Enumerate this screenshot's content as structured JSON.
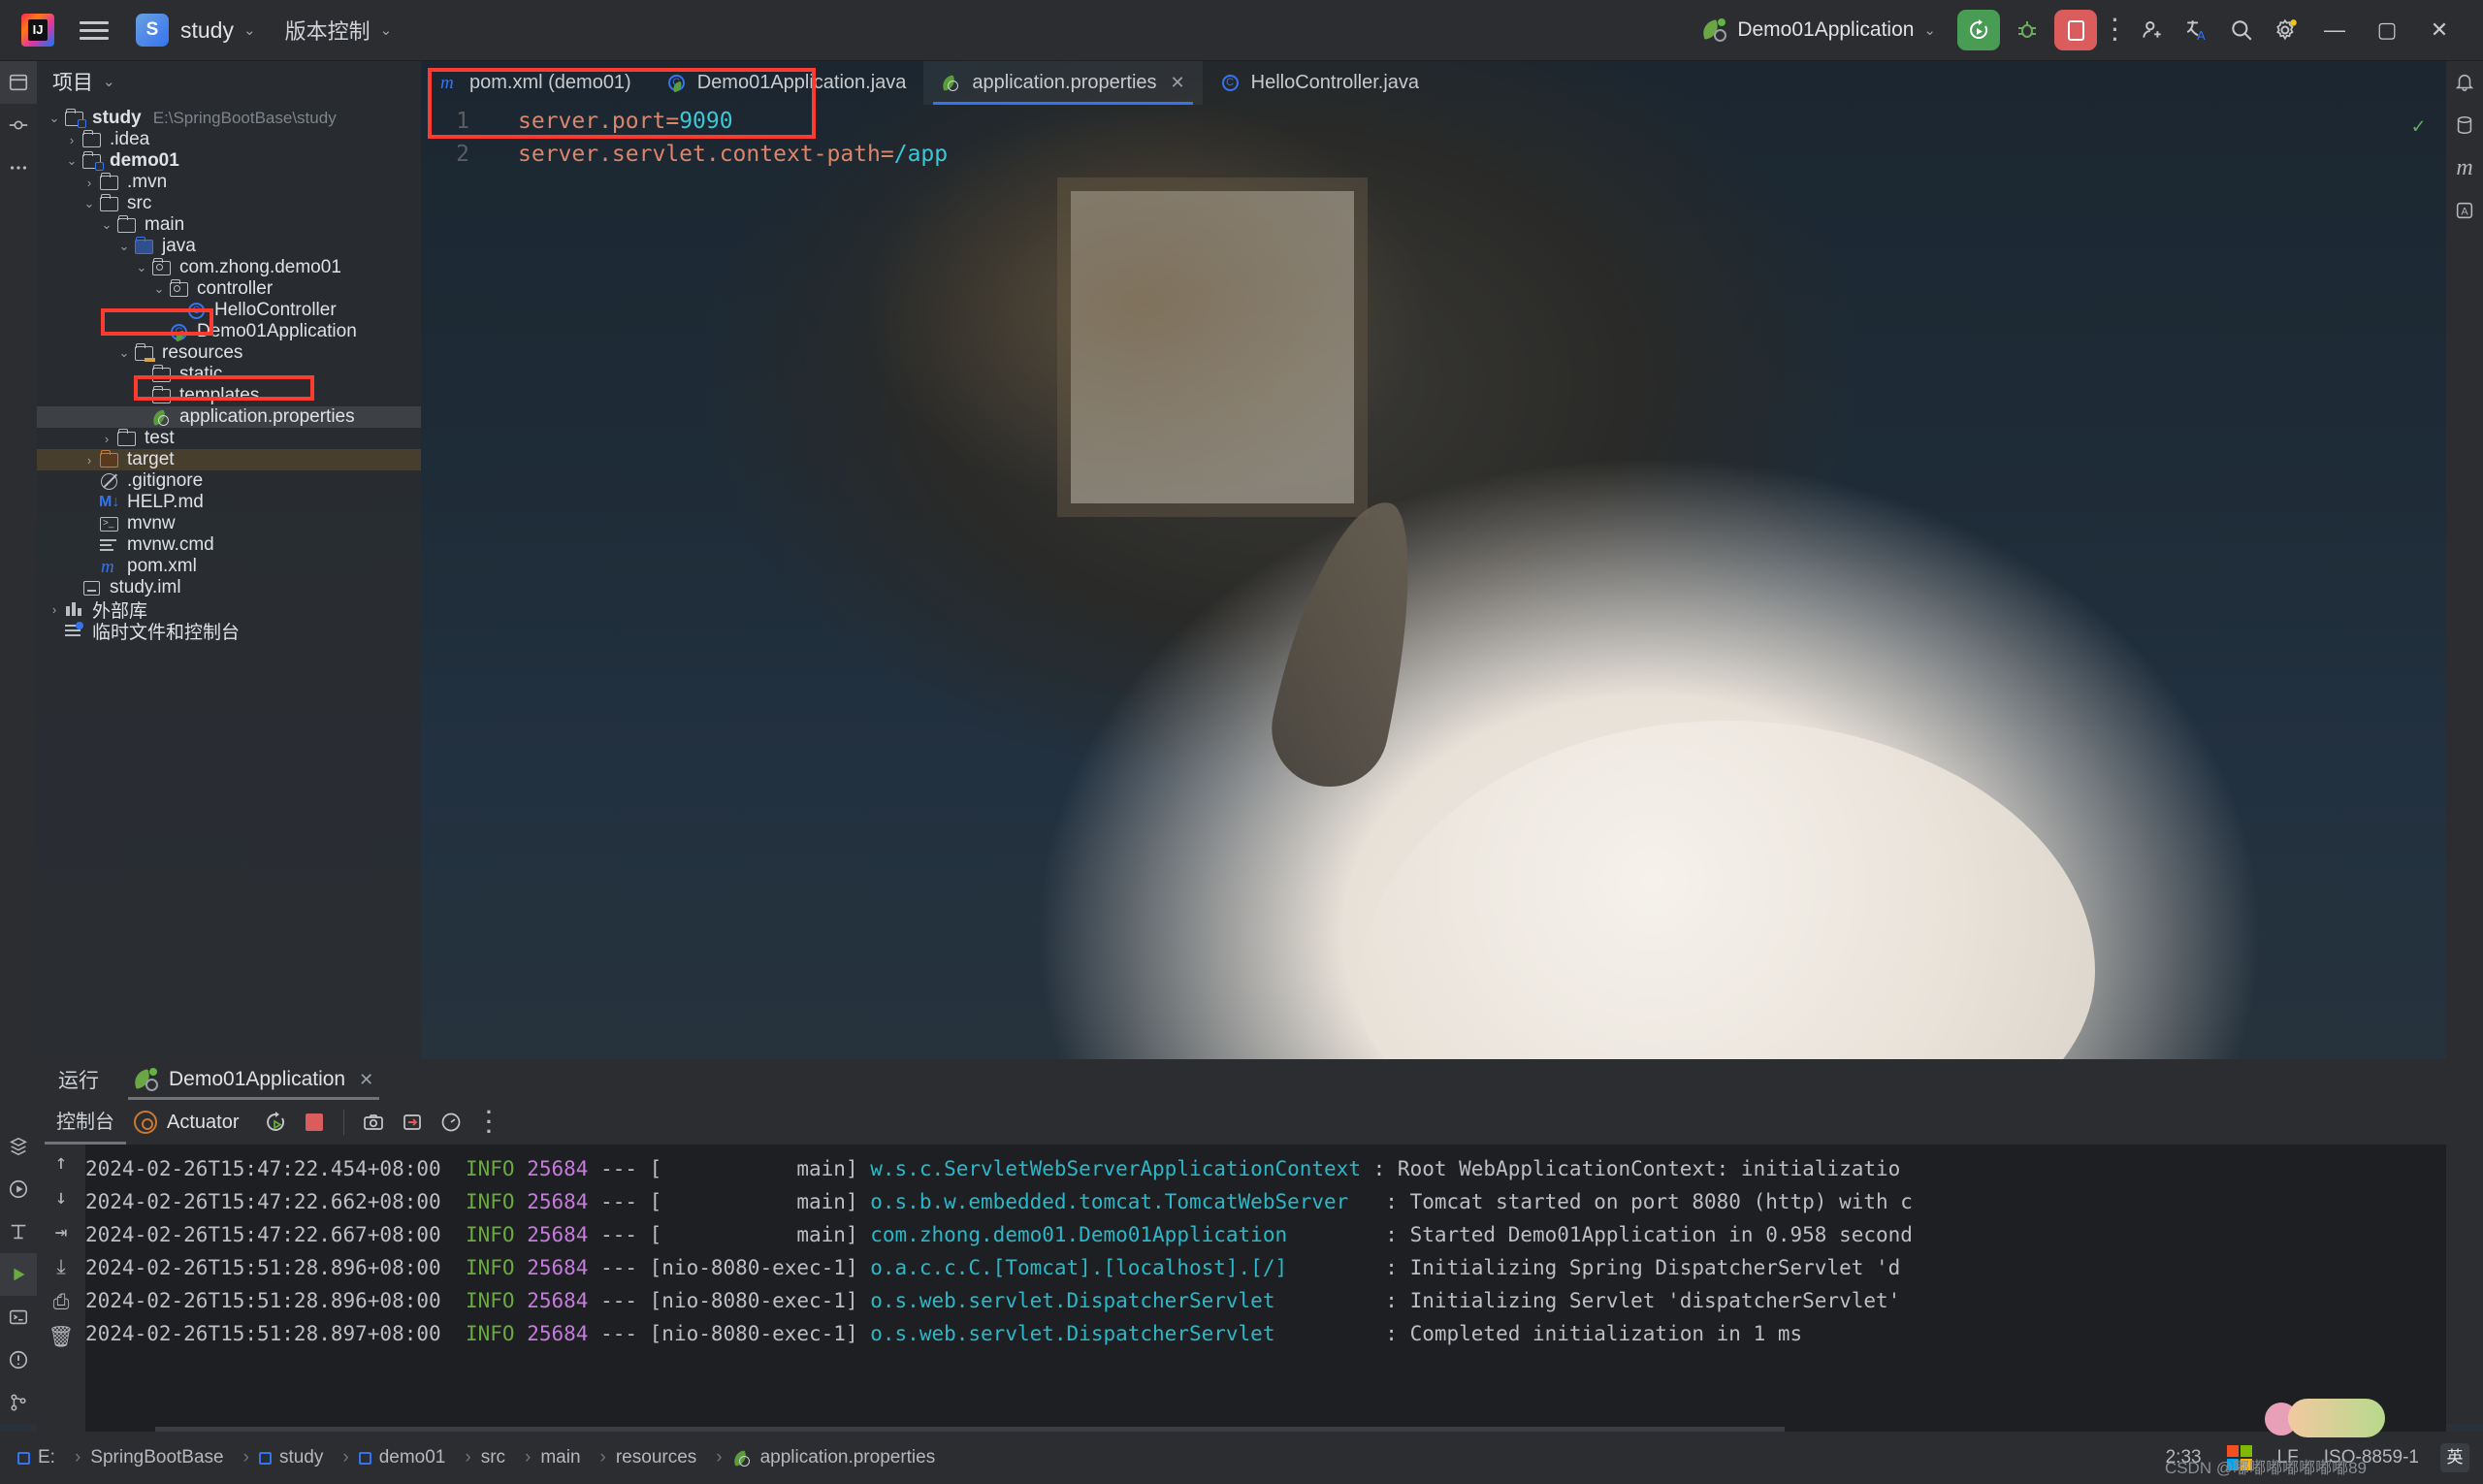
{
  "titlebar": {
    "app_icon": "intellij-idea-logo",
    "menu_icon": "hamburger-menu-icon",
    "project_initial": "S",
    "project_name": "study",
    "vcs_label": "版本控制",
    "run_config": "Demo01Application",
    "run_icon": "run-icon",
    "debug_icon": "debug-icon",
    "stop_icon": "stop-icon",
    "more_icon": "more-vertical-icon",
    "account_icon": "add-user-icon",
    "translate_icon": "translate-icon",
    "search_icon": "search-icon",
    "settings_icon": "gear-icon",
    "minimize": "—",
    "maximize": "▢",
    "close": "✕",
    "accent_blue": "#3574f0",
    "run_green": "#499c54",
    "stop_red": "#db5c5c"
  },
  "leftbar": {
    "items": [
      {
        "name": "project-tool-window-icon",
        "glyph": "▢"
      },
      {
        "name": "commit-icon",
        "glyph": "⌗"
      },
      {
        "name": "more-tool-windows-icon",
        "glyph": "⋯"
      },
      {
        "name": "services-icon",
        "glyph": "≋"
      },
      {
        "name": "run-tool-window-icon",
        "glyph": "▷"
      },
      {
        "name": "structure-icon",
        "glyph": "T"
      },
      {
        "name": "run-anything-icon",
        "glyph": "▶"
      },
      {
        "name": "terminal-icon",
        "glyph": "▭"
      },
      {
        "name": "problems-icon",
        "glyph": "!"
      },
      {
        "name": "version-control-icon",
        "glyph": "⑂"
      }
    ]
  },
  "rightbar": {
    "items": [
      {
        "name": "notifications-icon",
        "glyph": "🔔"
      },
      {
        "name": "database-icon",
        "glyph": "▤"
      },
      {
        "name": "maven-icon",
        "glyph": "m"
      },
      {
        "name": "ai-assistant-icon",
        "glyph": "A"
      }
    ]
  },
  "project_panel": {
    "title": "项目",
    "chevron": "chevron-down-icon",
    "tree": [
      {
        "depth": 0,
        "arrow": "down",
        "icon": "module-folder-icon",
        "label": "study",
        "sub": "E:\\SpringBootBase\\study",
        "bold": true
      },
      {
        "depth": 1,
        "arrow": "right",
        "icon": "folder-icon",
        "label": ".idea"
      },
      {
        "depth": 1,
        "arrow": "down",
        "icon": "module-folder-icon",
        "label": "demo01",
        "bold": true
      },
      {
        "depth": 2,
        "arrow": "right",
        "icon": "folder-icon",
        "label": ".mvn"
      },
      {
        "depth": 2,
        "arrow": "down",
        "icon": "folder-icon",
        "label": "src"
      },
      {
        "depth": 3,
        "arrow": "down",
        "icon": "folder-icon",
        "label": "main"
      },
      {
        "depth": 4,
        "arrow": "down",
        "icon": "source-root-folder-icon",
        "label": "java"
      },
      {
        "depth": 5,
        "arrow": "down",
        "icon": "package-icon",
        "label": "com.zhong.demo01"
      },
      {
        "depth": 6,
        "arrow": "down",
        "icon": "package-icon",
        "label": "controller"
      },
      {
        "depth": 7,
        "arrow": "none",
        "icon": "java-class-icon",
        "label": "HelloController"
      },
      {
        "depth": 6,
        "arrow": "none",
        "icon": "spring-boot-class-icon",
        "label": "Demo01Application"
      },
      {
        "depth": 4,
        "arrow": "down",
        "icon": "resources-root-folder-icon",
        "label": "resources",
        "highlight": "red-box"
      },
      {
        "depth": 5,
        "arrow": "none",
        "icon": "folder-icon",
        "label": "static"
      },
      {
        "depth": 5,
        "arrow": "none",
        "icon": "folder-icon",
        "label": "templates"
      },
      {
        "depth": 5,
        "arrow": "none",
        "icon": "spring-properties-icon",
        "label": "application.properties",
        "selected": true,
        "highlight": "red-box"
      },
      {
        "depth": 3,
        "arrow": "right",
        "icon": "folder-icon",
        "label": "test"
      },
      {
        "depth": 2,
        "arrow": "right",
        "icon": "excluded-folder-icon",
        "label": "target",
        "excluded": true
      },
      {
        "depth": 2,
        "arrow": "none",
        "icon": "gitignore-icon",
        "label": ".gitignore"
      },
      {
        "depth": 2,
        "arrow": "none",
        "icon": "markdown-icon",
        "label": "HELP.md"
      },
      {
        "depth": 2,
        "arrow": "none",
        "icon": "shell-script-icon",
        "label": "mvnw"
      },
      {
        "depth": 2,
        "arrow": "none",
        "icon": "cmd-file-icon",
        "label": "mvnw.cmd"
      },
      {
        "depth": 2,
        "arrow": "none",
        "icon": "maven-pom-icon",
        "label": "pom.xml"
      },
      {
        "depth": 1,
        "arrow": "none",
        "icon": "iml-file-icon",
        "label": "study.iml"
      },
      {
        "depth": 0,
        "arrow": "right",
        "icon": "external-libraries-icon",
        "label": "外部库"
      },
      {
        "depth": 0,
        "arrow": "none",
        "icon": "scratches-icon",
        "label": "临时文件和控制台"
      }
    ]
  },
  "editor": {
    "tabs": [
      {
        "label": "pom.xml (demo01)",
        "icon": "maven-pom-icon",
        "active": false,
        "closable": false
      },
      {
        "label": "Demo01Application.java",
        "icon": "spring-boot-class-icon",
        "active": false,
        "closable": false
      },
      {
        "label": "application.properties",
        "icon": "spring-properties-icon",
        "active": true,
        "closable": true,
        "close_glyph": "✕"
      },
      {
        "label": "HelloController.java",
        "icon": "java-class-icon",
        "active": false,
        "closable": false
      }
    ],
    "inspection_ok_glyph": "✓",
    "lines": [
      {
        "num": "1",
        "key": "server.port",
        "eq": "=",
        "value": "9090"
      },
      {
        "num": "2",
        "key": "server.servlet.context-path",
        "eq": "=",
        "value": "/app"
      }
    ],
    "highlight": "red-box-around-code"
  },
  "run_panel": {
    "tool_label": "运行",
    "tab_label": "Demo01Application",
    "tab_icon": "spring-boot-run-icon",
    "tab_close_glyph": "✕",
    "console_label": "控制台",
    "actuator_label": "Actuator",
    "actuator_icon": "actuator-icon",
    "rerun_icon": "rerun-icon",
    "stop_icon": "stop-icon",
    "camera_icon": "camera-icon",
    "open-in-icon": "open-in-icon",
    "dashboard_icon": "dashboard-icon",
    "more_icon": "more-vertical-icon",
    "gutter_icons": [
      "scroll-up-icon",
      "scroll-down-icon",
      "soft-wrap-icon",
      "scroll-to-end-icon",
      "print-icon",
      "clear-all-icon"
    ],
    "log_lines": [
      {
        "ts": "2024-02-26T15:47:22.454+08:00",
        "level": "INFO",
        "pid": "25684",
        "sep": "---",
        "thread": "[           main]",
        "cls": "w.s.c.ServletWebServerApplicationContext",
        "msg": ": Root WebApplicationContext: initializatio"
      },
      {
        "ts": "2024-02-26T15:47:22.662+08:00",
        "level": "INFO",
        "pid": "25684",
        "sep": "---",
        "thread": "[           main]",
        "cls": "o.s.b.w.embedded.tomcat.TomcatWebServer  ",
        "msg": ": Tomcat started on port 8080 (http) with c"
      },
      {
        "ts": "2024-02-26T15:47:22.667+08:00",
        "level": "INFO",
        "pid": "25684",
        "sep": "---",
        "thread": "[           main]",
        "cls": "com.zhong.demo01.Demo01Application       ",
        "msg": ": Started Demo01Application in 0.958 second"
      },
      {
        "ts": "2024-02-26T15:51:28.896+08:00",
        "level": "INFO",
        "pid": "25684",
        "sep": "---",
        "thread": "[nio-8080-exec-1]",
        "cls": "o.a.c.c.C.[Tomcat].[localhost].[/]       ",
        "msg": ": Initializing Spring DispatcherServlet 'd"
      },
      {
        "ts": "2024-02-26T15:51:28.896+08:00",
        "level": "INFO",
        "pid": "25684",
        "sep": "---",
        "thread": "[nio-8080-exec-1]",
        "cls": "o.s.web.servlet.DispatcherServlet        ",
        "msg": ": Initializing Servlet 'dispatcherServlet'"
      },
      {
        "ts": "2024-02-26T15:51:28.897+08:00",
        "level": "INFO",
        "pid": "25684",
        "sep": "---",
        "thread": "[nio-8080-exec-1]",
        "cls": "o.s.web.servlet.DispatcherServlet        ",
        "msg": ": Completed initialization in 1 ms"
      }
    ]
  },
  "status_bar": {
    "breadcrumbs": [
      {
        "label": "E:",
        "box": true
      },
      {
        "label": "SpringBootBase",
        "box": false
      },
      {
        "label": "study",
        "box": true
      },
      {
        "label": "demo01",
        "box": true
      },
      {
        "label": "src",
        "box": false
      },
      {
        "label": "main",
        "box": false
      },
      {
        "label": "resources",
        "box": false
      },
      {
        "label": "application.properties",
        "box": false,
        "icon": "spring-properties-icon"
      }
    ],
    "separator": "›",
    "caret_position": "2:33",
    "line_separator": "LF",
    "encoding": "ISO-8859-1",
    "ime_label": "英",
    "watermark": "CSDN @嘟嘟嘟嘟嘟嘟嘟89"
  }
}
